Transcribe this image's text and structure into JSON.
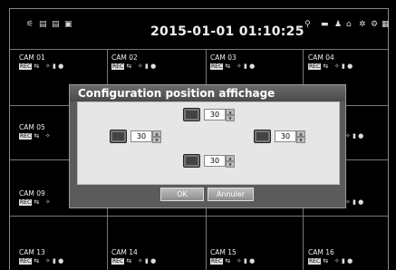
{
  "topbar": {
    "date": "2015-01-01 01:10:25"
  },
  "cameras": [
    {
      "name": "CAM 01"
    },
    {
      "name": "CAM 02"
    },
    {
      "name": "CAM 03"
    },
    {
      "name": "CAM 04"
    },
    {
      "name": "CAM 05"
    },
    {
      "name": "CAM 09"
    },
    {
      "name": "CAM 13"
    },
    {
      "name": "CAM 14"
    },
    {
      "name": "CAM 15"
    },
    {
      "name": "CAM 16"
    }
  ],
  "dialog": {
    "title": "Configuration position affichage",
    "top_value": "30",
    "left_value": "30",
    "right_value": "30",
    "bottom_value": "30",
    "ok_label": "OK",
    "cancel_label": "Annuler"
  }
}
